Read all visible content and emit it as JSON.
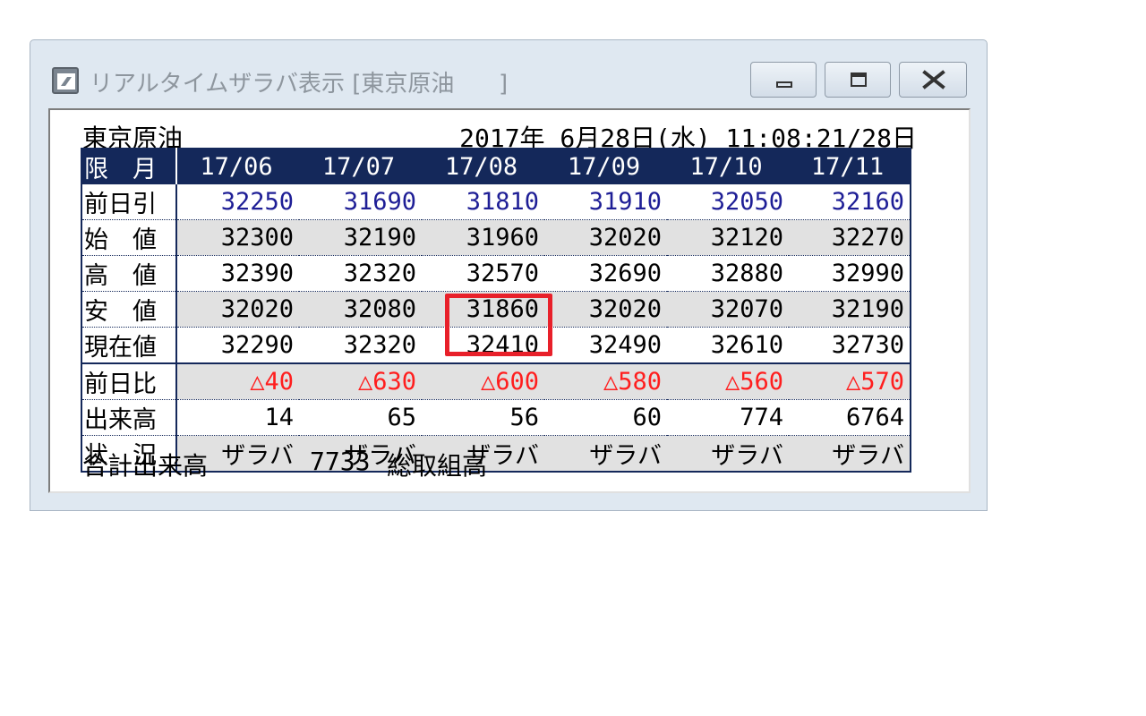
{
  "window": {
    "title": "リアルタイムザラバ表示 [東京原油      ]",
    "icon": "app-icon",
    "buttons": {
      "minimize": "minimize-icon",
      "maximize": "maximize-icon",
      "close": "close-icon"
    }
  },
  "header": {
    "product": "東京原油",
    "datetime": "2017年 6月28日(水) 11:08:21/28日"
  },
  "board": {
    "row_label_header": "限　月",
    "months": [
      "17/06",
      "17/07",
      "17/08",
      "17/09",
      "17/10",
      "17/11"
    ],
    "rows": [
      {
        "label": "前日引",
        "color": "#1e1e96",
        "values": [
          "32250",
          "31690",
          "31810",
          "31910",
          "32050",
          "32160"
        ]
      },
      {
        "label": "始　値",
        "color": "#000000",
        "values": [
          "32300",
          "32190",
          "31960",
          "32020",
          "32120",
          "32270"
        ]
      },
      {
        "label": "高　値",
        "color": "#000000",
        "values": [
          "32390",
          "32320",
          "32570",
          "32690",
          "32880",
          "32990"
        ]
      },
      {
        "label": "安　値",
        "color": "#000000",
        "values": [
          "32020",
          "32080",
          "31860",
          "32020",
          "32070",
          "32190"
        ]
      },
      {
        "label": "現在値",
        "color": "#000000",
        "values": [
          "32290",
          "32320",
          "32410",
          "32490",
          "32610",
          "32730"
        ]
      },
      {
        "label": "前日比",
        "color": "#ff1e1e",
        "values": [
          "△40",
          "△630",
          "△600",
          "△580",
          "△560",
          "△570"
        ]
      },
      {
        "label": "出来高",
        "color": "#000000",
        "values": [
          "14",
          "65",
          "56",
          "60",
          "774",
          "6764"
        ]
      },
      {
        "label": "状　況",
        "color": "#000000",
        "values": [
          "ザラバ",
          "ザラバ",
          "ザラバ",
          "ザラバ",
          "ザラバ",
          "ザラバ"
        ]
      }
    ]
  },
  "footer": {
    "total_volume_label": "合計出来高",
    "total_volume_value": "7733",
    "open_interest_label": "総取組高"
  },
  "colors": {
    "header_bg": "#14285a",
    "shade_bg": "#e1e1e1",
    "highlight": "#e8202a"
  }
}
